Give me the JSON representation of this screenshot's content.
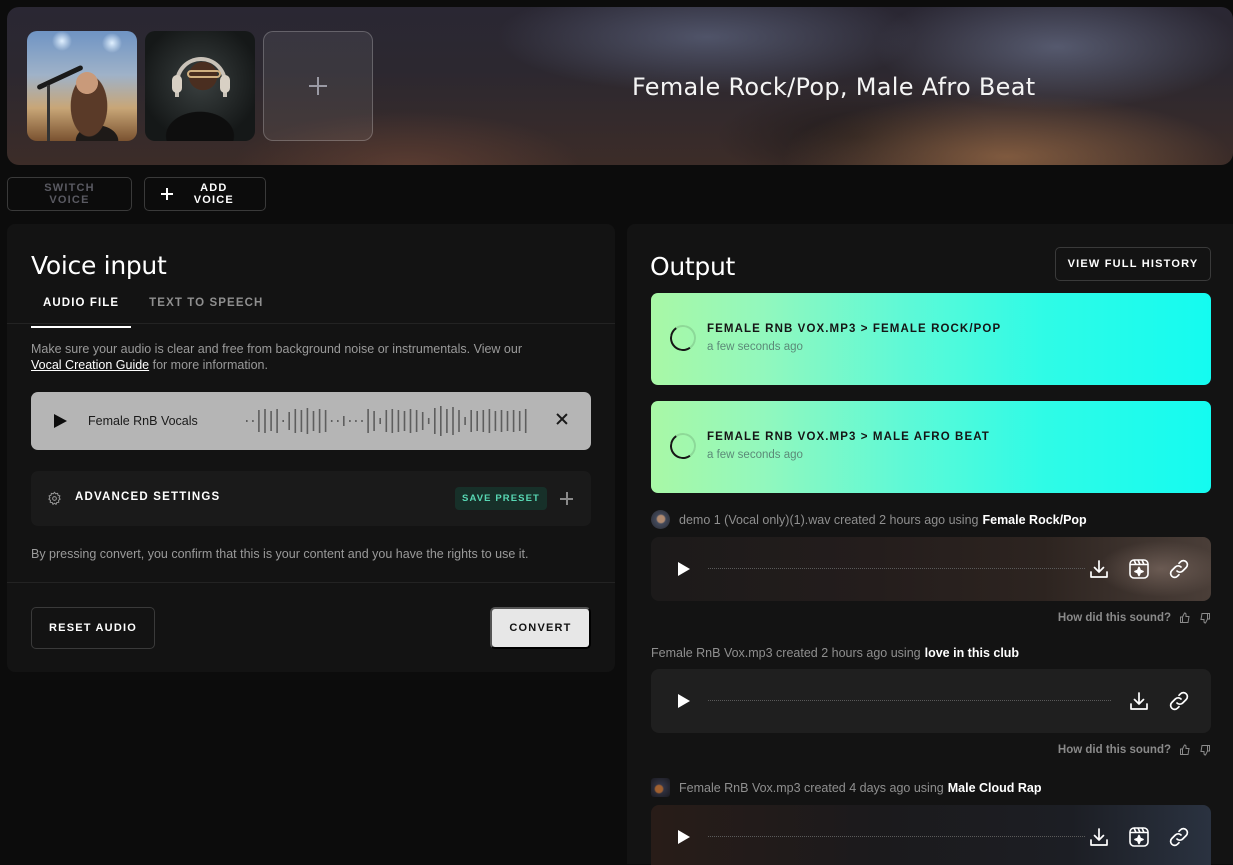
{
  "hero": {
    "title": "Female Rock/Pop, Male Afro Beat",
    "voices": [
      {
        "name": "Female Rock/Pop"
      },
      {
        "name": "Male Afro Beat"
      }
    ],
    "add_slot_icon": "plus-icon"
  },
  "actions": {
    "switch_voice": "SWITCH VOICE",
    "add_voice": "ADD VOICE"
  },
  "voice_input": {
    "title": "Voice input",
    "tabs": [
      {
        "label": "AUDIO FILE",
        "active": true
      },
      {
        "label": "TEXT TO SPEECH",
        "active": false
      }
    ],
    "info_text": "Make sure your audio is clear and free from background noise or instrumentals. View our",
    "info_link": "Vocal Creation Guide",
    "info_suffix": "for more information.",
    "audio_file": {
      "name": "Female RnB Vocals"
    },
    "advanced_settings": "ADVANCED SETTINGS",
    "save_preset": "SAVE PRESET",
    "consent": "By pressing convert, you confirm that this is your content and you have the rights to use it.",
    "reset_audio": "RESET AUDIO",
    "convert": "CONVERT"
  },
  "output": {
    "title": "Output",
    "view_history": "VIEW FULL HISTORY",
    "pending": [
      {
        "title": "FEMALE RNB VOX.MP3 > FEMALE ROCK/POP",
        "time": "a few seconds ago"
      },
      {
        "title": "FEMALE RNB VOX.MP3 > MALE AFRO BEAT",
        "time": "a few seconds ago"
      }
    ],
    "history": [
      {
        "meta": "demo 1 (Vocal only)(1).wav created 2 hours ago using",
        "voice": "Female Rock/Pop",
        "has_video": true
      },
      {
        "meta": "Female RnB Vox.mp3 created 2 hours ago using",
        "voice": "love in this club",
        "has_video": false
      },
      {
        "meta": "Female RnB Vox.mp3 created 4 days ago using",
        "voice": "Male Cloud Rap",
        "has_video": true
      }
    ],
    "feedback_prompt": "How did this sound?"
  },
  "colors": {
    "accent_gradient_start": "#a9f8a6",
    "accent_gradient_end": "#14fbf0",
    "save_preset_text": "#58d8b4"
  }
}
